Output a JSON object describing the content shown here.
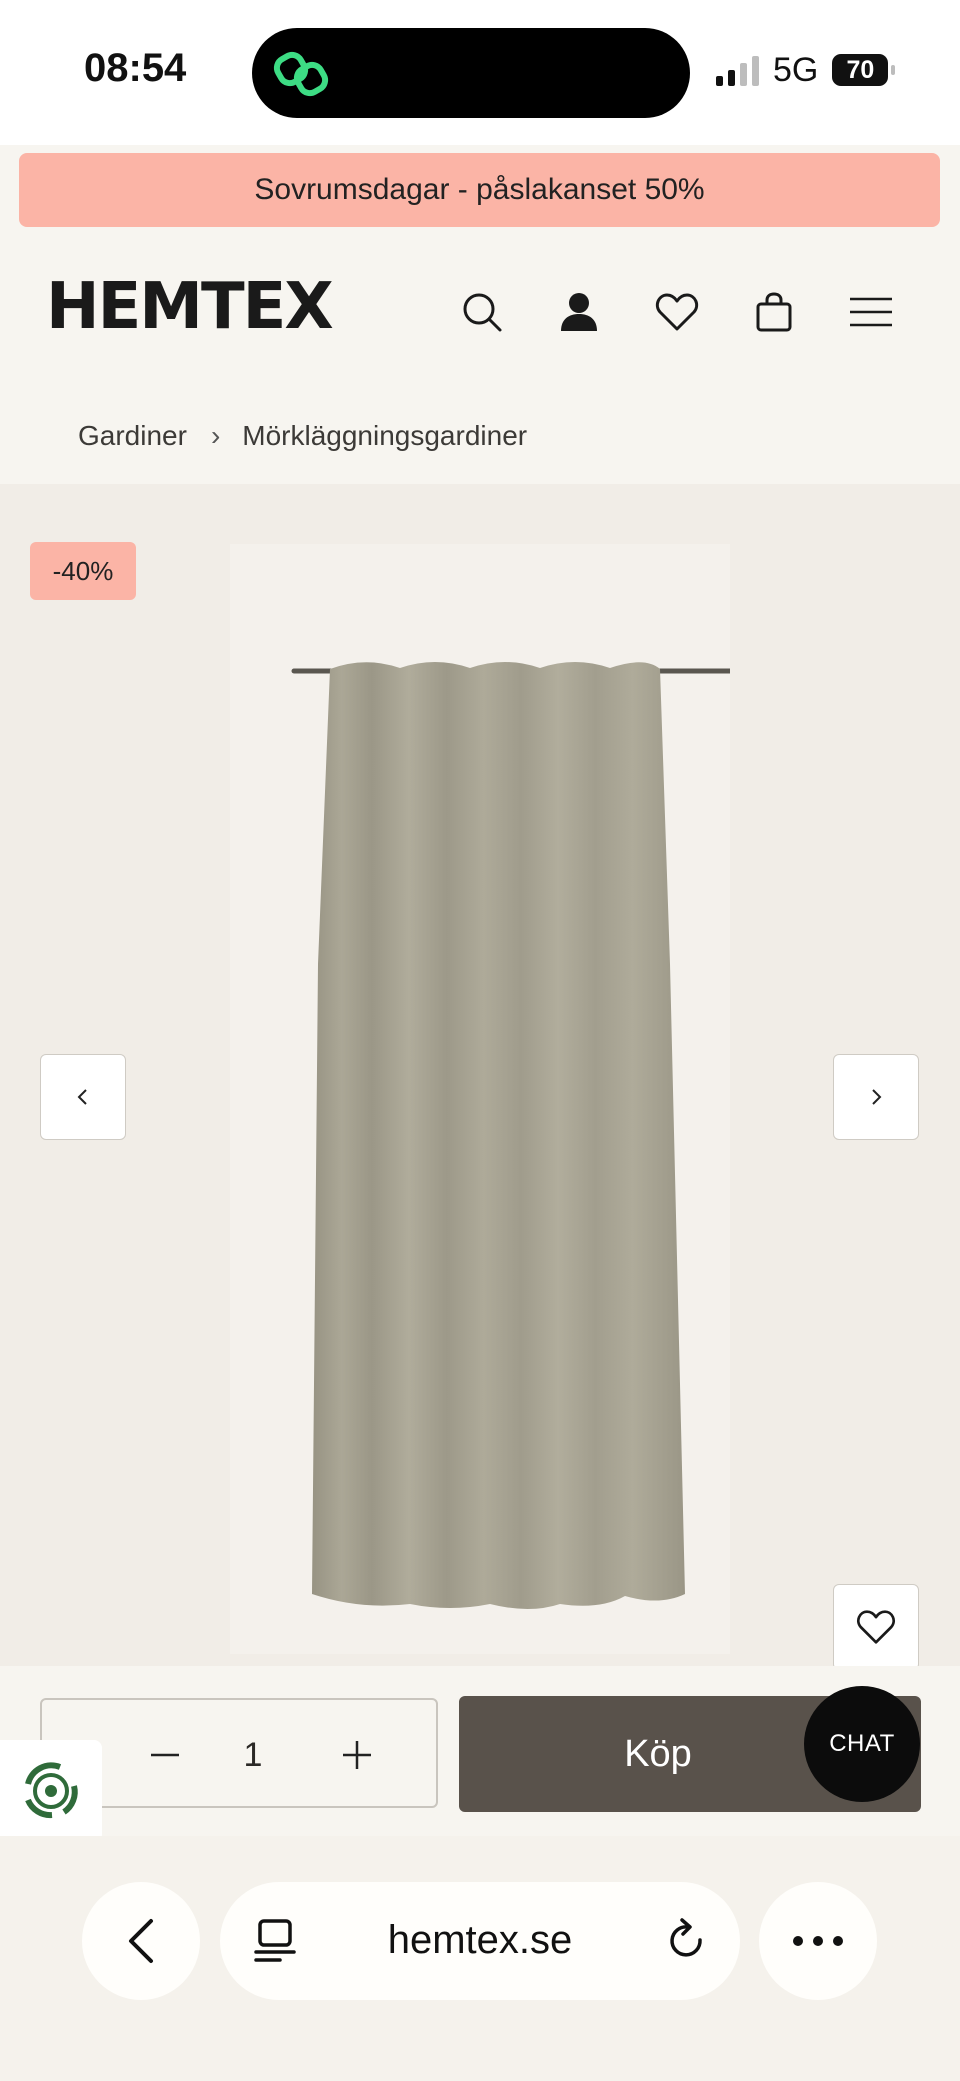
{
  "status_bar": {
    "time": "08:54",
    "network": "5G",
    "battery": "70"
  },
  "promo": {
    "text": "Sovrumsdagar - påslakanset 50%"
  },
  "header": {
    "logo": "HEMTEX",
    "icons": [
      "search-icon",
      "account-icon",
      "heart-icon",
      "bag-icon",
      "menu-icon"
    ]
  },
  "breadcrumb": {
    "items": [
      "Gardiner",
      "Mörkläggningsgardiner"
    ],
    "separator": "›"
  },
  "product": {
    "discount_badge": "-40%"
  },
  "buy_bar": {
    "quantity": "1",
    "buy_label": "Köp",
    "chat_label": "CHAT"
  },
  "browser": {
    "url": "hemtex.se"
  },
  "colors": {
    "promo": "#fbb4a6",
    "buy_button": "#59524b",
    "background": "#f7f5f0",
    "curtain": "#a39f90"
  }
}
